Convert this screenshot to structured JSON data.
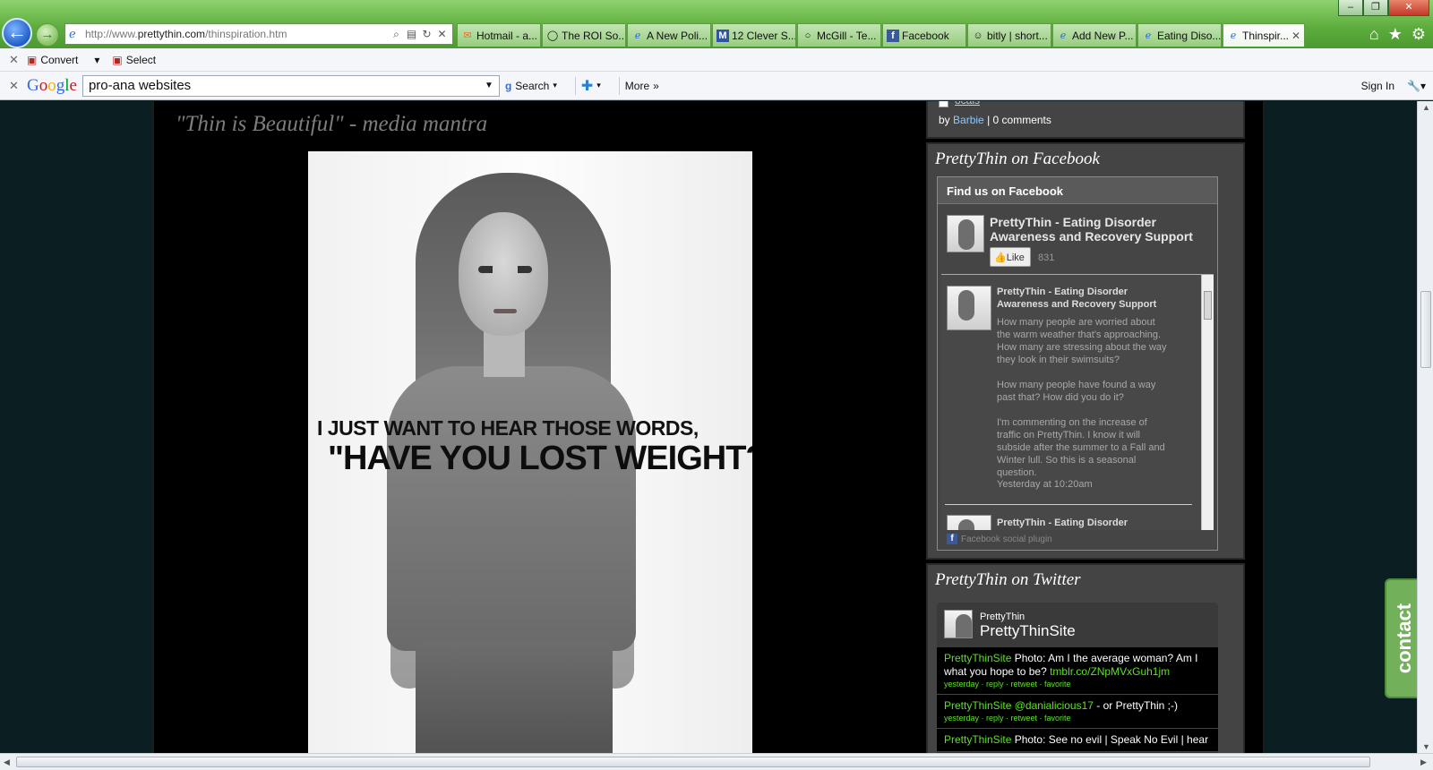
{
  "browser": {
    "caption": {
      "minimize": "‒",
      "restore": "❐",
      "close": "✕"
    },
    "address_url_prefix": "http://www.",
    "address_url_domain": "prettythin.com",
    "address_url_path": "/thinspiration.htm",
    "tabs": [
      {
        "label": "Hotmail - a...",
        "icon": "hotmail-icon"
      },
      {
        "label": "The ROI So...",
        "icon": "globe-icon"
      },
      {
        "label": "A New Poli...",
        "icon": "ie-icon"
      },
      {
        "label": "12 Clever S...",
        "icon": "m-icon"
      },
      {
        "label": "McGill - Te...",
        "icon": "circle-icon"
      },
      {
        "label": "Facebook",
        "icon": "facebook-icon"
      },
      {
        "label": "bitly | short...",
        "icon": "bitly-icon"
      },
      {
        "label": "Add New P...",
        "icon": "ie-icon"
      },
      {
        "label": "Eating Diso...",
        "icon": "ie-icon"
      },
      {
        "label": "Thinspir...",
        "icon": "ie-icon",
        "active": true
      }
    ],
    "command_bar": {
      "convert_label": "Convert",
      "select_label": "Select"
    },
    "google_toolbar": {
      "logo": [
        "G",
        "o",
        "o",
        "g",
        "l",
        "e"
      ],
      "query": "pro-ana websites",
      "search_label": "Search",
      "more_label": "More",
      "signin_label": "Sign In"
    }
  },
  "page": {
    "post_heading": "\"Thin is Beautiful\" - media mantra",
    "image_quote_line1": "I JUST WANT TO HEAR THOSE WORDS,",
    "image_quote_line2": "\"HAVE YOU LOST WEIGHT?\"",
    "top_widget": {
      "link_fragment": "ocais",
      "by": "by",
      "author": "Barbie",
      "separator": "|",
      "comments": "0 comments"
    },
    "facebook_widget": {
      "title": "PrettyThin on Facebook",
      "find_us": "Find us on Facebook",
      "page_name": "PrettyThin - Eating Disorder Awareness and Recovery Support",
      "like_label": "Like",
      "like_count": "831",
      "post_author": "PrettyThin - Eating Disorder Awareness and Recovery Support",
      "post_text": "How many people are worried about the warm weather that's approaching. How many are stressing about the way they look in their swimsuits?\n\nHow many people have found a way past that? How did you do it?\n\nI'm commenting on the increase of traffic on PrettyThin. I know it will subside after the summer to a Fall and Winter lull. So this is a seasonal question.",
      "post_time": "Yesterday at 10:20am",
      "next_post_author": "PrettyThin - Eating Disorder",
      "plugin_label": "Facebook social plugin"
    },
    "twitter_widget": {
      "title": "PrettyThin on Twitter",
      "name": "PrettyThin",
      "handle": "PrettyThinSite",
      "tweets": [
        {
          "user": "PrettyThinSite",
          "text": " Photo: Am I the average woman? Am I what you hope to be? ",
          "link": "tmblr.co/ZNpMVxGuh1jm",
          "meta": "yesterday · reply · retweet · favorite"
        },
        {
          "user": "PrettyThinSite",
          "mention": "@danialicious17",
          "text": " - or PrettyThin ;-)",
          "meta": "yesterday · reply · retweet · favorite"
        },
        {
          "user": "PrettyThinSite",
          "text": " Photo: See no evil | Speak No Evil | hear"
        }
      ]
    },
    "contact_label": "contact"
  }
}
